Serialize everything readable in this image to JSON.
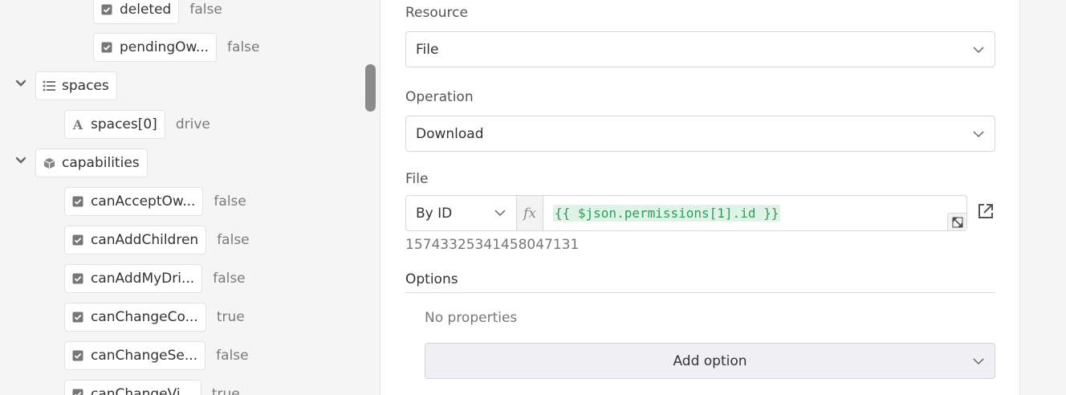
{
  "tree": {
    "items": [
      {
        "label": "deleted",
        "value": "false",
        "icon": "checkbox-icon"
      },
      {
        "label": "pendingOw...",
        "value": "false",
        "icon": "checkbox-icon"
      },
      {
        "label": "spaces",
        "value": "",
        "icon": "list-icon",
        "expanded": true
      },
      {
        "label": "spaces[0]",
        "value": "drive",
        "icon": "string-icon",
        "glyph": "A"
      },
      {
        "label": "capabilities",
        "value": "",
        "icon": "cube-icon",
        "expanded": true
      },
      {
        "label": "canAcceptOw...",
        "value": "false",
        "icon": "checkbox-icon"
      },
      {
        "label": "canAddChildren",
        "value": "false",
        "icon": "checkbox-icon"
      },
      {
        "label": "canAddMyDri...",
        "value": "false",
        "icon": "checkbox-icon"
      },
      {
        "label": "canChangeCo...",
        "value": "true",
        "icon": "checkbox-icon"
      },
      {
        "label": "canChangeSe...",
        "value": "false",
        "icon": "checkbox-icon"
      },
      {
        "label": "canChangeVi...",
        "value": "true",
        "icon": "checkbox-icon"
      }
    ]
  },
  "form": {
    "resource": {
      "label": "Resource",
      "value": "File"
    },
    "operation": {
      "label": "Operation",
      "value": "Download"
    },
    "file": {
      "label": "File",
      "mode": "By ID",
      "fx": "fx",
      "expression": "{{ $json.permissions[1].id }}",
      "resolved": "15743325341458047131"
    },
    "options": {
      "title": "Options",
      "empty_text": "No properties",
      "add_label": "Add option"
    }
  },
  "colors": {
    "accent_expr_text": "#2e9a5a",
    "accent_expr_bg": "#dff4e6",
    "scroll_thumb": "#8b8b8b"
  }
}
